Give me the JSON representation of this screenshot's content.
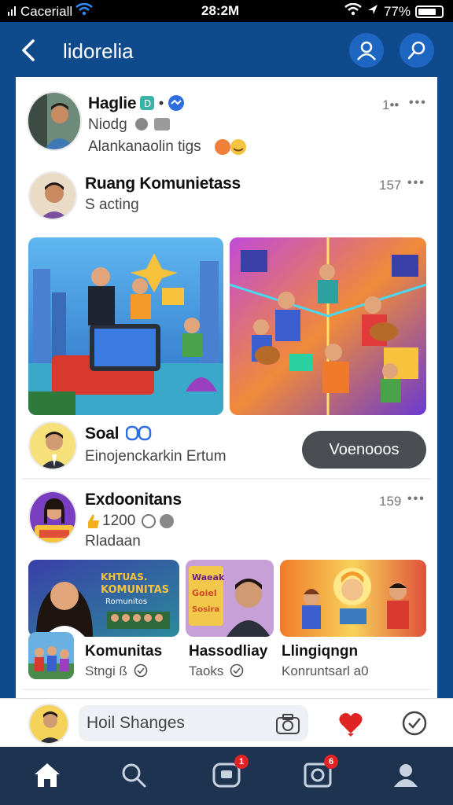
{
  "status_bar": {
    "carrier": "Caceriall",
    "time": "28:2M",
    "battery": "77%",
    "battery_level": 0.77
  },
  "header": {
    "title": "lidorelia"
  },
  "posts": [
    {
      "name": "Haglie",
      "line2": "Niodg",
      "line3": "Alankanaolin tigs",
      "meta": "1••",
      "more": "•••"
    },
    {
      "name": "Ruang Komunietass",
      "line2": "S acting",
      "meta": "157",
      "more": "•••"
    }
  ],
  "shared": {
    "name": "Soal",
    "sub": "Einojenckarkin Ertum",
    "action_label": "Voenooos"
  },
  "post3": {
    "name": "Exdoonitans",
    "meta_line": "1200",
    "sub": "Rladaan",
    "time": "159",
    "more": "•••"
  },
  "tiles": [
    {
      "title": "Komunitas",
      "sub": "Stngi ß"
    },
    {
      "title": "Hassodliay",
      "sub": "Taoks"
    },
    {
      "title": "Llingiqngn",
      "sub": "Konruntsarl a0"
    }
  ],
  "tile_banner": {
    "line1": "KHTUAS.",
    "line2": "KOMUNITAS",
    "line3": "Romunitos",
    "poster1": "Waeak",
    "poster2": "Goiel",
    "poster3": "Sosira"
  },
  "composer": {
    "placeholder": "Hoil Shanges"
  },
  "nav": {
    "badge_messages": "1",
    "badge_notifications": "6"
  },
  "colors": {
    "header_bg": "#0f4a8c",
    "accent": "#1d66c2",
    "nav_bg": "#1d3350",
    "badge": "#e02424",
    "pill": "#4a4d52"
  },
  "icons": [
    "back-arrow-icon",
    "profile-icon",
    "search-icon",
    "camera-icon",
    "heart-icon",
    "check-icon",
    "home-icon",
    "messages-icon",
    "notifications-icon",
    "person-icon"
  ]
}
